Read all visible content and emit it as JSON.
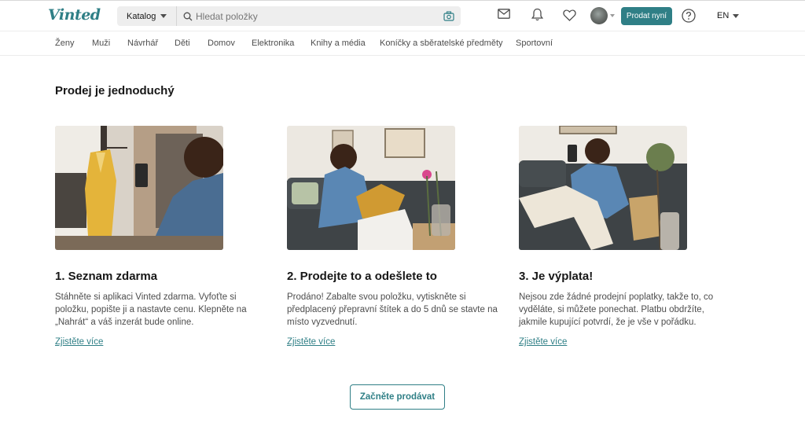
{
  "header": {
    "logo": "Vinted",
    "catalog_label": "Katalog",
    "search_placeholder": "Hledat položky",
    "sell_button": "Prodat nyní",
    "language": "EN",
    "icons": [
      "mail-icon",
      "bell-icon",
      "heart-icon",
      "help-icon"
    ]
  },
  "categories": [
    "Ženy",
    "Muži",
    "Návrhář",
    "Děti",
    "Domov",
    "Elektronika",
    "Knihy a média",
    "Koníčky a sběratelské předměty",
    "Sportovní"
  ],
  "main": {
    "title": "Prodej je jednoduchý",
    "steps": [
      {
        "title": "1. Seznam zdarma",
        "text": "Stáhněte si aplikaci Vinted zdarma. Vyfoťte si položku, popište ji a nastavte cenu. Klepněte na „Nahrát“ a váš inzerát bude online.",
        "link": "Zjistěte více"
      },
      {
        "title": "2. Prodejte to a odešlete to",
        "text": "Prodáno! Zabalte svou položku, vytiskněte si předplacený přepravní štítek a do 5 dnů se stavte na místo vyzvednutí.",
        "link": "Zjistěte více"
      },
      {
        "title": "3. Je výplata!",
        "text": "Nejsou zde žádné prodejní poplatky, takže to, co vyděláte, si můžete ponechat. Platbu obdržíte, jakmile kupující potvrdí, že je vše v pořádku.",
        "link": "Zjistěte více"
      }
    ],
    "cta": "Začněte prodávat"
  },
  "colors": {
    "brand": "#2f7f86",
    "text": "#171717",
    "muted": "#4d4d4d"
  }
}
